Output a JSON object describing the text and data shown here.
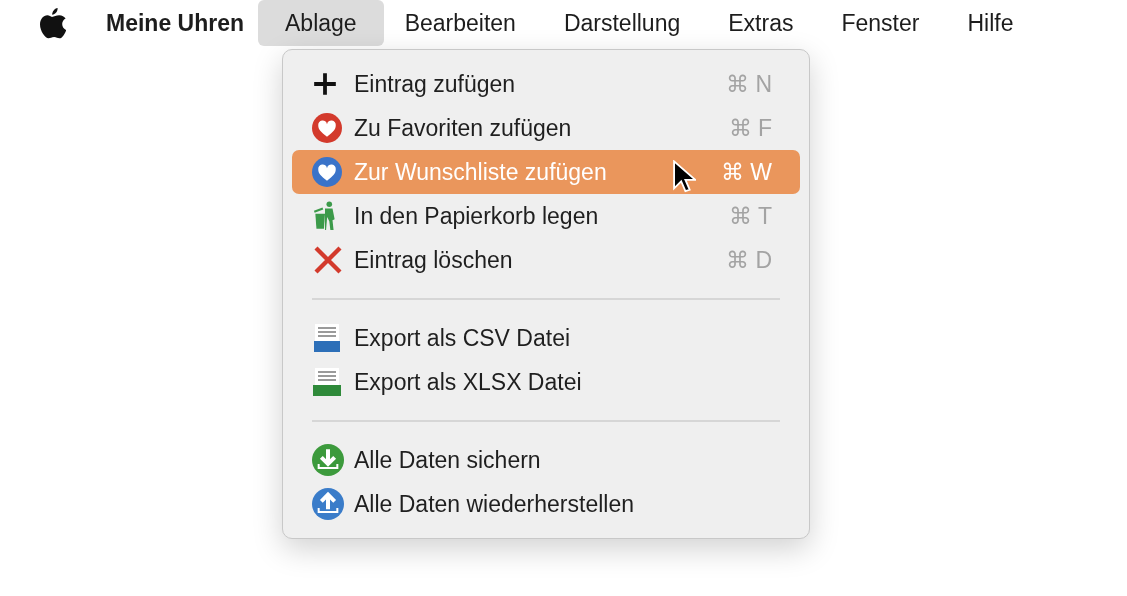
{
  "menu_bar": {
    "app_name": "Meine Uhren",
    "menus": [
      {
        "label": "Ablage",
        "selected": true
      },
      {
        "label": "Bearbeiten",
        "selected": false
      },
      {
        "label": "Darstellung",
        "selected": false
      },
      {
        "label": "Extras",
        "selected": false
      },
      {
        "label": "Fenster",
        "selected": false
      },
      {
        "label": "Hilfe",
        "selected": false
      }
    ]
  },
  "dropdown": {
    "items": [
      {
        "kind": "item",
        "label": "Eintrag zufügen",
        "shortcut": "⌘ N",
        "selected": false
      },
      {
        "kind": "item",
        "label": "Zu Favoriten zufügen",
        "shortcut": "⌘ F",
        "selected": false
      },
      {
        "kind": "item",
        "label": "Zur Wunschliste zufügen",
        "shortcut": "⌘ W",
        "selected": true
      },
      {
        "kind": "item",
        "label": "In den Papierkorb legen",
        "shortcut": "⌘ T",
        "selected": false
      },
      {
        "kind": "item",
        "label": "Eintrag löschen",
        "shortcut": "⌘ D",
        "selected": false
      },
      {
        "kind": "separator"
      },
      {
        "kind": "item",
        "label": "Export als CSV Datei",
        "selected": false
      },
      {
        "kind": "item",
        "label": "Export als XLSX Datei",
        "selected": false
      },
      {
        "kind": "separator"
      },
      {
        "kind": "item",
        "label": "Alle Daten sichern",
        "selected": false
      },
      {
        "kind": "item",
        "label": "Alle Daten wiederherstellen",
        "selected": false
      }
    ]
  }
}
